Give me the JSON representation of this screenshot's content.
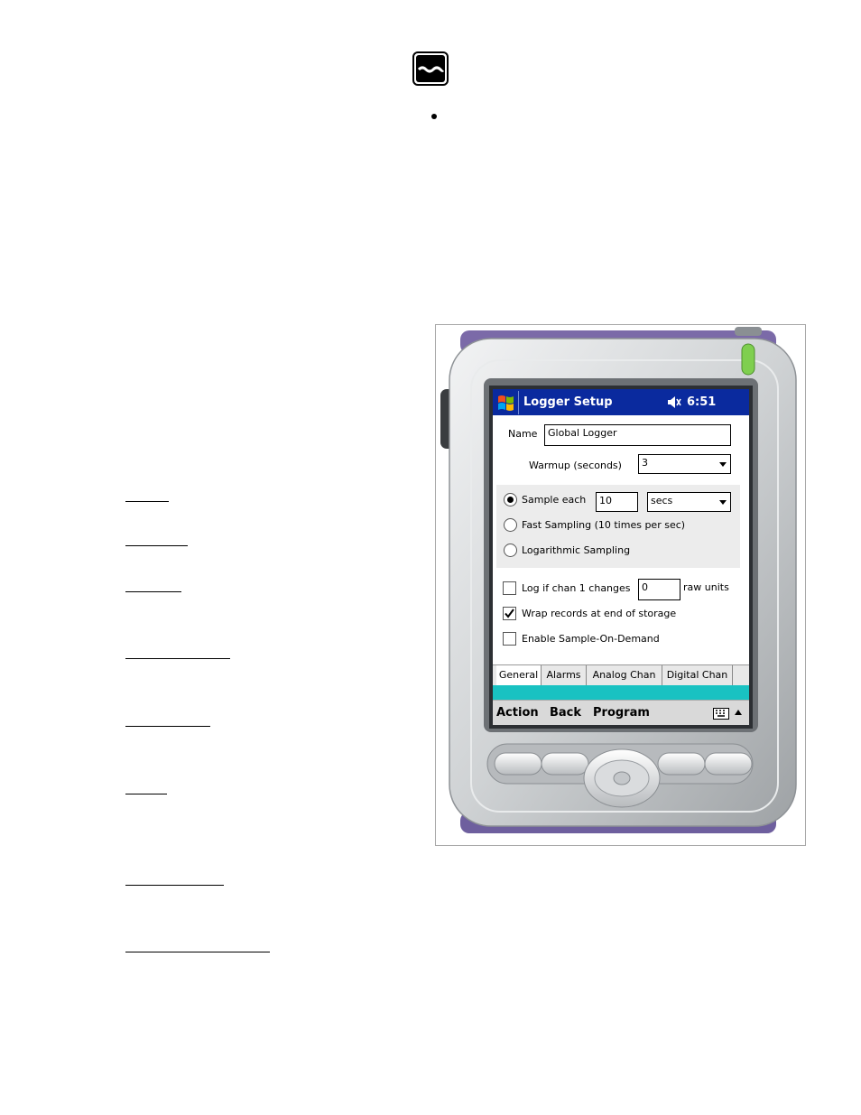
{
  "icons": {
    "logo": "water-wave-logo-icon",
    "start": "windows-flag-icon",
    "speaker": "speaker-muted-icon",
    "keyboard": "keyboard-icon",
    "menu_up": "up-arrow-icon"
  },
  "titlebar": {
    "title": "Logger Setup",
    "time": "6:51"
  },
  "general": {
    "name_label": "Name",
    "name_value": "Global Logger",
    "warmup_label": "Warmup (seconds)",
    "warmup_value": "3"
  },
  "sampling": {
    "sample_each_label": "Sample each",
    "sample_each_value": "10",
    "sample_unit": "secs",
    "fast_label": "Fast Sampling (10 times per sec)",
    "log_label": "Logarithmic Sampling",
    "selected": "sample_each"
  },
  "options": {
    "log_change_label": "Log if chan 1 changes",
    "log_change_value": "0",
    "raw_units_label": "raw units",
    "log_change_checked": false,
    "wrap_label": "Wrap records at end of storage",
    "wrap_checked": true,
    "sod_label": "Enable Sample-On-Demand",
    "sod_checked": false
  },
  "tabs": [
    "General",
    "Alarms",
    "Analog Chan",
    "Digital Chan"
  ],
  "active_tab": "General",
  "menu": {
    "action": "Action",
    "back": "Back",
    "program": "Program"
  },
  "colors": {
    "titlebar": "#0a2a9e",
    "teal_bar": "#19c2c2",
    "device_purple": "#7b6aa8"
  }
}
